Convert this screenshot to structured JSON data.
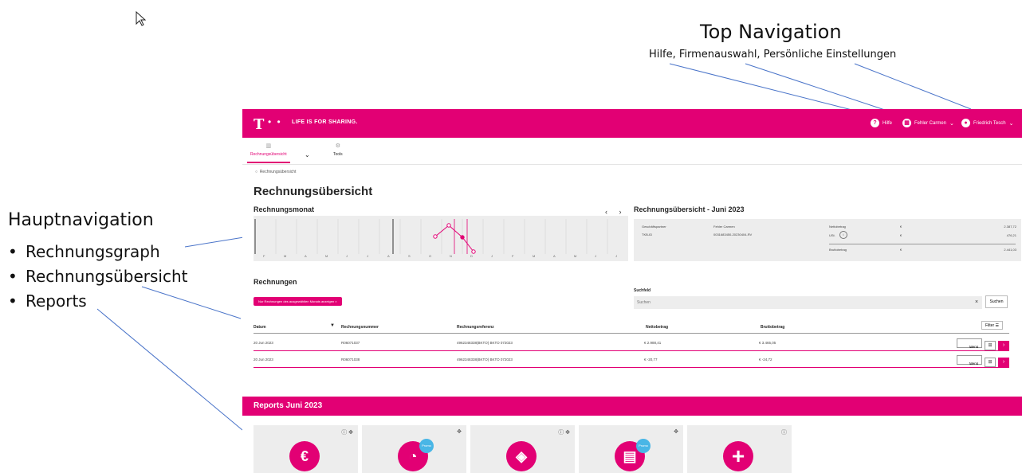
{
  "annotations": {
    "top_title": "Top Navigation",
    "top_subtitle": "Hilfe, Firmenauswahl, Persönliche Einstellungen",
    "haupt_title": "Hauptnavigation",
    "bullet": "•",
    "haupt_items": [
      "Rechnungsgraph",
      "Rechnungsübersicht",
      "Reports"
    ]
  },
  "topbar": {
    "logo": "T",
    "logo_dots": "• •",
    "slogan": "LIFE IS FOR SHARING.",
    "help_label": "Hilfe",
    "company_label": "Fehler Carmen",
    "user_label": "Friedrich Tesch",
    "chevron": "⌄"
  },
  "mainnav": {
    "tabs": [
      {
        "label": "Rechnungsübersicht",
        "icon": "invoice-icon"
      },
      {
        "label": "Tools",
        "icon": "gear-icon"
      }
    ],
    "chevron": "⌄"
  },
  "breadcrumb": "Rechnungsübersicht",
  "page_title": "Rechnungsübersicht",
  "graph": {
    "title": "Rechnungsmonat",
    "arrows": "‹ ›",
    "month_labels": [
      "F",
      "M",
      "A",
      "M",
      "J",
      "J",
      "A",
      "S",
      "O",
      "N",
      "D",
      "J",
      "F",
      "M",
      "A",
      "M",
      "J",
      "J"
    ]
  },
  "summary": {
    "title": "Rechnungsübersicht - Juni 2023",
    "partner_label": "Geschäftspartner",
    "partner_value": "Fehler Carmen",
    "id_label": "TKB-ID",
    "id_value": "0031683450-20230404-RV",
    "net_label": "Nettobetrag",
    "vat_label": "USt.",
    "gross_label": "Bruttobetrag",
    "currency": "€",
    "net_value": "2.387,72",
    "vat_value": "476,21",
    "gross_value": "2.441,03"
  },
  "invoices": {
    "title": "Rechnungen",
    "filter_pill": "Nur Rechnungen des ausgewählten Monats anzeigen ×",
    "search_label": "Suchfeld",
    "search_placeholder": "Suchen",
    "search_clear": "×",
    "search_button": "Suchen",
    "filter_button": "Filter",
    "columns": [
      "Datum",
      "Rechnungsnummer",
      "Rechnungsreferenz",
      "Nettobetrag",
      "Bruttobetrag"
    ],
    "sort_indicator": "▼",
    "rows": [
      {
        "date": "20 Jun 2023",
        "number": "R06071037",
        "reference": "4962348338(BKTO) BKTO 072023",
        "net": "€ 2.988,41",
        "gross": "€ 3.465,05"
      },
      {
        "date": "20 Jun 2023",
        "number": "R06071038",
        "reference": "4962348338(BKTO) BKTO 072023",
        "net": "€ -20,77",
        "gross": "€ -24,72"
      }
    ],
    "menu_label": "Menü",
    "menu_chevron": "⌄",
    "row_go": "›"
  },
  "reports": {
    "title": "Reports Juni 2023",
    "tiles": [
      {
        "icon": "euro-invoice-icon",
        "glyph": "€",
        "ctl": "ⓘ ✥",
        "badge": ""
      },
      {
        "icon": "gauge-icon",
        "glyph": "◔",
        "ctl": "✥",
        "badge": "Promo"
      },
      {
        "icon": "box-icon",
        "glyph": "◈",
        "ctl": "ⓘ ✥",
        "badge": ""
      },
      {
        "icon": "document-chart-icon",
        "glyph": "▤",
        "ctl": "✥",
        "badge": "Promo"
      },
      {
        "icon": "plus-icon",
        "glyph": "+",
        "ctl": "ⓘ",
        "badge": ""
      }
    ]
  },
  "colors": {
    "brand": "#e20074",
    "panel": "#ededed",
    "promo": "#49b6e6"
  }
}
